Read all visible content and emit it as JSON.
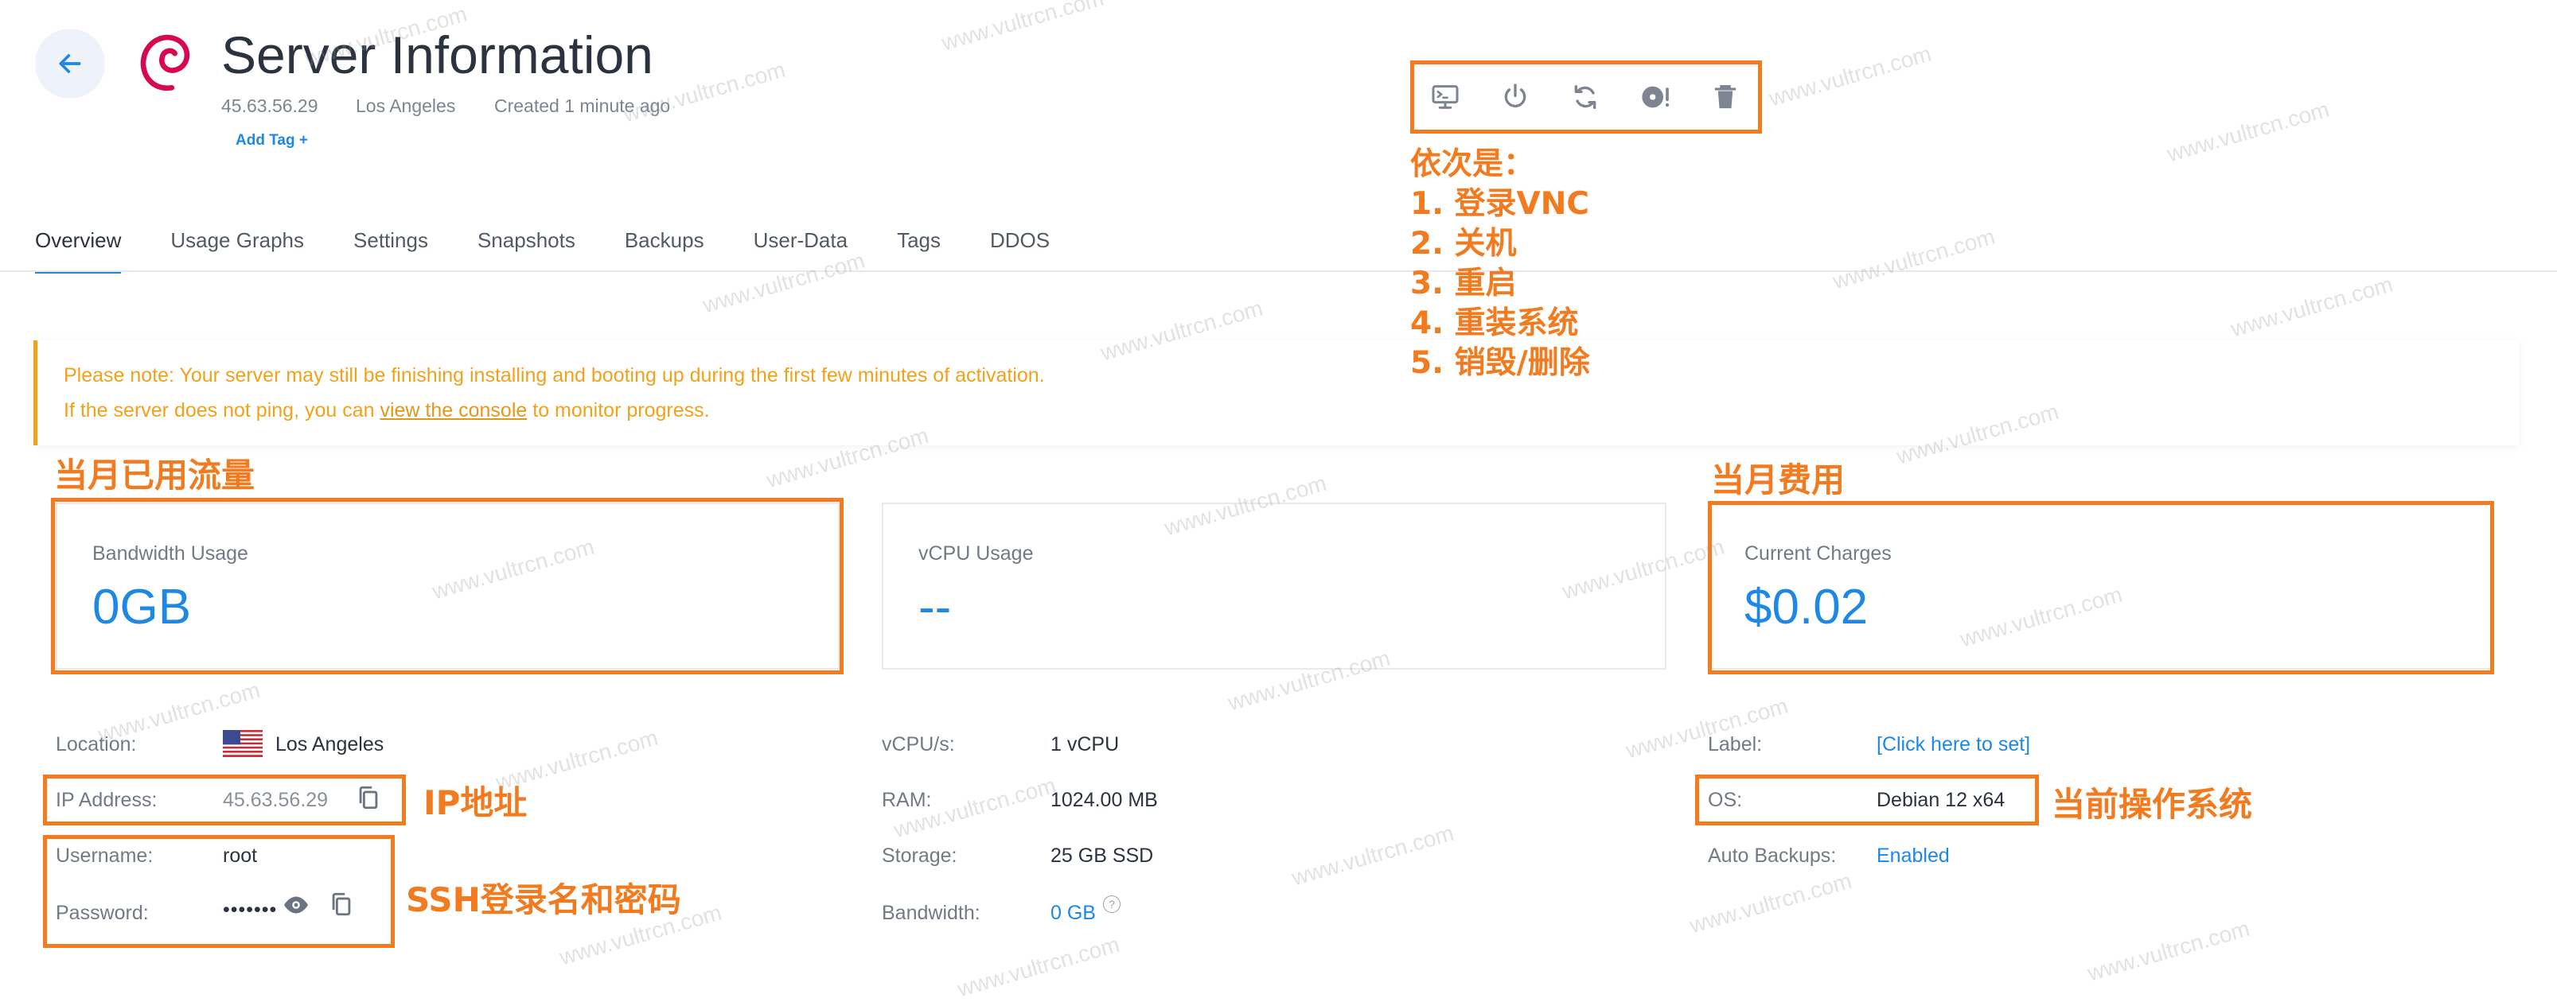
{
  "header": {
    "title": "Server Information",
    "ip": "45.63.56.29",
    "location": "Los Angeles",
    "created": "Created 1 minute ago",
    "add_tag": "Add Tag +"
  },
  "actions": [
    {
      "name": "vnc-console",
      "icon": "monitor-terminal-icon"
    },
    {
      "name": "power",
      "icon": "power-icon"
    },
    {
      "name": "restart",
      "icon": "refresh-icon"
    },
    {
      "name": "reinstall",
      "icon": "disc-alert-icon"
    },
    {
      "name": "destroy",
      "icon": "trash-icon"
    }
  ],
  "tabs": [
    "Overview",
    "Usage Graphs",
    "Settings",
    "Snapshots",
    "Backups",
    "User-Data",
    "Tags",
    "DDOS"
  ],
  "notice": {
    "line1": "Please note: Your server may still be finishing installing and booting up during the first few minutes of activation.",
    "line2_pre": "If the server does not ping, you can ",
    "line2_link": "view the console",
    "line2_post": " to monitor progress."
  },
  "cards": {
    "bandwidth": {
      "label": "Bandwidth Usage",
      "value": "0GB"
    },
    "vcpu": {
      "label": "vCPU Usage",
      "value": "--"
    },
    "charges": {
      "label": "Current Charges",
      "value": "$0.02"
    }
  },
  "details": {
    "location_label": "Location:",
    "location_value": "Los Angeles",
    "ip_label": "IP Address:",
    "ip_value": "45.63.56.29",
    "username_label": "Username:",
    "username_value": "root",
    "password_label": "Password:",
    "password_value": "•••••••",
    "vcpus_label": "vCPU/s:",
    "vcpus_value": "1 vCPU",
    "ram_label": "RAM:",
    "ram_value": "1024.00 MB",
    "storage_label": "Storage:",
    "storage_value": "25 GB SSD",
    "bandwidth_label": "Bandwidth:",
    "bandwidth_value": "0 GB",
    "bandwidth_help": "?",
    "label_label": "Label:",
    "label_value": "[Click here to set]",
    "os_label": "OS:",
    "os_value": "Debian 12 x64",
    "backups_label": "Auto Backups:",
    "backups_value": "Enabled"
  },
  "annotations": {
    "actions_title": "依次是：",
    "actions_items": [
      "1. 登录VNC",
      "2. 关机",
      "3. 重启",
      "4. 重装系统",
      "5. 销毁/删除"
    ],
    "bandwidth": "当月已用流量",
    "charges": "当月费用",
    "ip": "IP地址",
    "ssh": "SSH登录名和密码",
    "os": "当前操作系统"
  },
  "watermark": "www.vultrcn.com",
  "colors": {
    "accent": "#1e88e5",
    "notice": "#f0a21a",
    "annotation": "#f47c20"
  }
}
